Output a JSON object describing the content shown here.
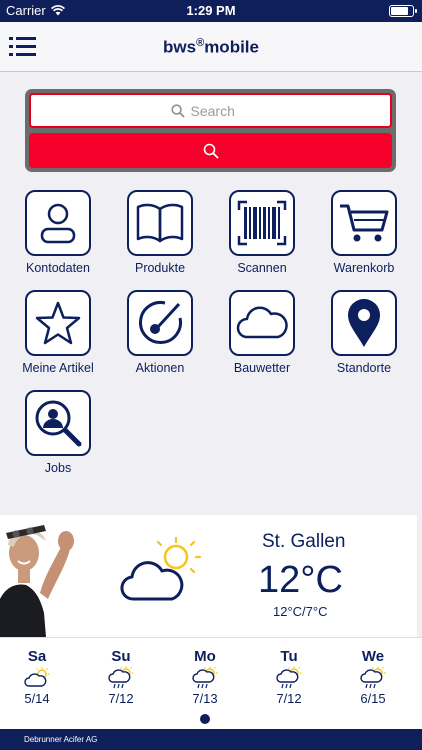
{
  "status": {
    "carrier": "Carrier",
    "time": "1:29 PM"
  },
  "nav": {
    "title": "bws",
    "title_sup": "®",
    "title_rest": "mobile",
    "menu_icon": "hamburger-icon"
  },
  "search": {
    "placeholder": "Search",
    "button_icon": "search-icon"
  },
  "colors": {
    "navy": "#0f1f5a",
    "accent_red": "#f5002a",
    "text_navy": "#0d1f5c"
  },
  "tiles": [
    {
      "label": "Kontodaten",
      "icon": "person-icon"
    },
    {
      "label": "Produkte",
      "icon": "book-icon"
    },
    {
      "label": "Scannen",
      "icon": "barcode-icon"
    },
    {
      "label": "Warenkorb",
      "icon": "cart-icon"
    },
    {
      "label": "Meine Artikel",
      "icon": "star-icon"
    },
    {
      "label": "Aktionen",
      "icon": "gauge-icon"
    },
    {
      "label": "Bauwetter",
      "icon": "cloud-icon"
    },
    {
      "label": "Standorte",
      "icon": "location-pin-icon"
    },
    {
      "label": "Jobs",
      "icon": "magnifier-person-icon"
    }
  ],
  "weather": {
    "city": "St. Gallen",
    "temp": "12°C",
    "range": "12°C/7°C",
    "icon": "partly-cloudy-icon",
    "days": [
      {
        "name": "Sa",
        "temps": "5/14",
        "icon": "partly-cloudy-icon"
      },
      {
        "name": "Su",
        "temps": "7/12",
        "icon": "rain-sun-icon"
      },
      {
        "name": "Mo",
        "temps": "7/13",
        "icon": "rain-sun-icon"
      },
      {
        "name": "Tu",
        "temps": "7/12",
        "icon": "rain-sun-icon"
      },
      {
        "name": "We",
        "temps": "6/15",
        "icon": "rain-sun-icon"
      }
    ]
  },
  "footer": {
    "text": "Debrunner Acifer AG"
  }
}
